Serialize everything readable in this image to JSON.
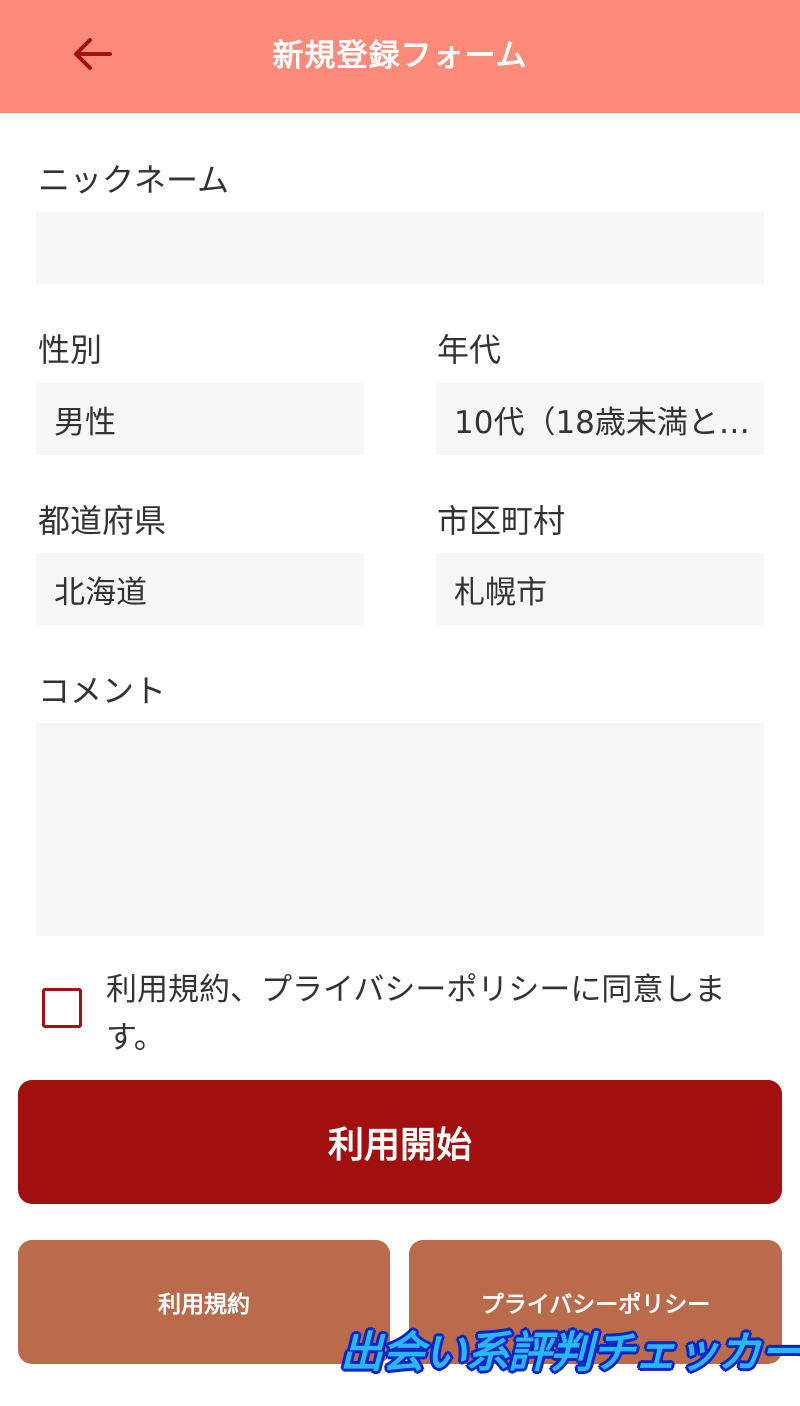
{
  "header": {
    "title": "新規登録フォーム",
    "back_icon": "arrow-left-icon"
  },
  "form": {
    "nickname": {
      "label": "ニックネーム",
      "value": ""
    },
    "gender": {
      "label": "性別",
      "value": "男性"
    },
    "age": {
      "label": "年代",
      "value": "10代（18歳未満と…"
    },
    "prefecture": {
      "label": "都道府県",
      "value": "北海道"
    },
    "city": {
      "label": "市区町村",
      "value": "札幌市"
    },
    "comment": {
      "label": "コメント",
      "value": ""
    },
    "agree": {
      "text": "利用規約、プライバシーポリシーに同意します。",
      "checked": false
    }
  },
  "buttons": {
    "start": "利用開始",
    "terms": "利用規約",
    "privacy": "プライバシーポリシー"
  },
  "watermark": "出会い系評判チェッカー",
  "colors": {
    "header_bg": "#fb8b78",
    "accent": "#a20f0f",
    "secondary_button": "#ba6b4c",
    "field_bg": "#f6f6f6"
  }
}
